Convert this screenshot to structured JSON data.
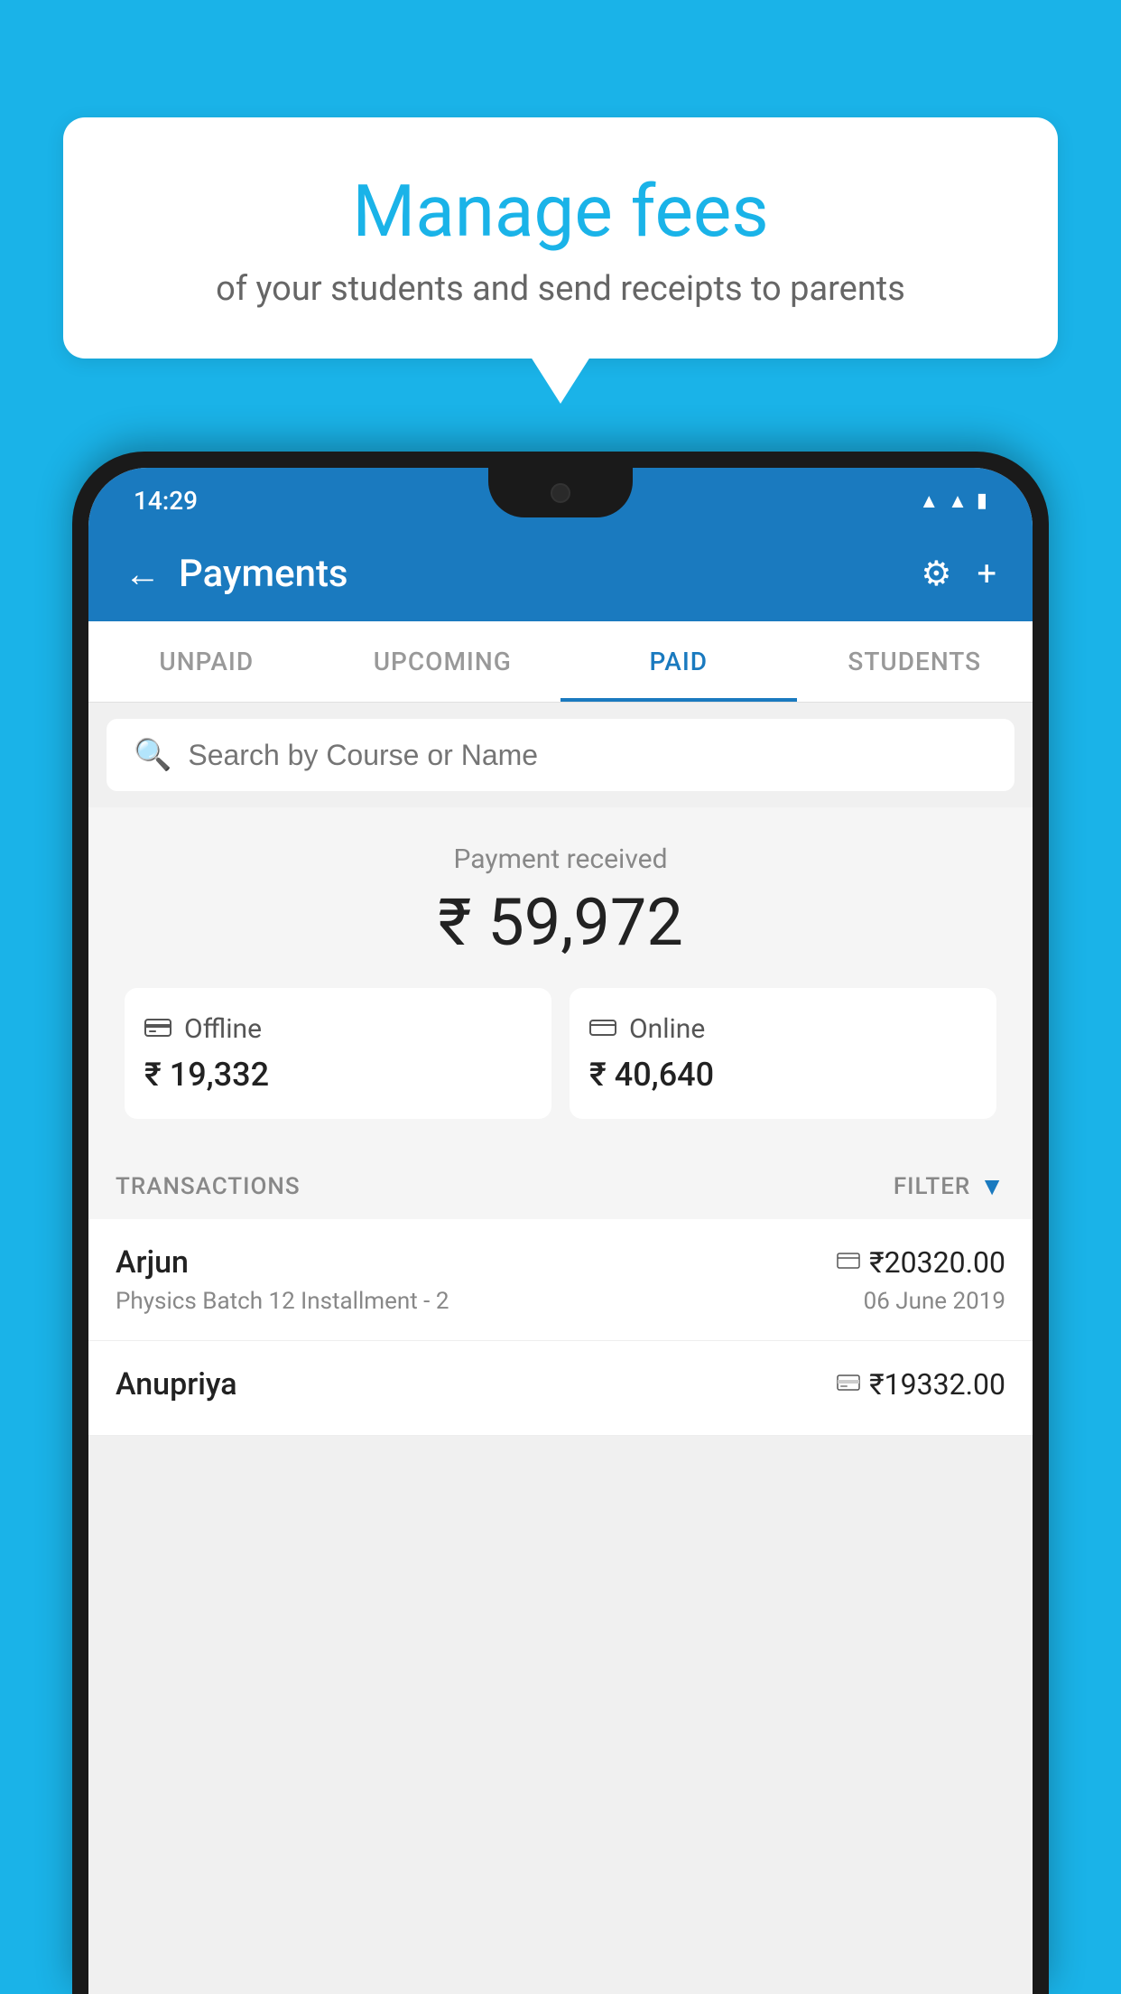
{
  "background_color": "#1ab3e8",
  "bubble": {
    "title": "Manage fees",
    "subtitle": "of your students and send receipts to parents"
  },
  "status_bar": {
    "time": "14:29",
    "wifi_icon": "▲",
    "signal_icon": "▲",
    "battery_icon": "▮"
  },
  "header": {
    "back_label": "←",
    "title": "Payments",
    "settings_icon": "⚙",
    "add_icon": "+"
  },
  "tabs": [
    {
      "id": "unpaid",
      "label": "UNPAID",
      "active": false
    },
    {
      "id": "upcoming",
      "label": "UPCOMING",
      "active": false
    },
    {
      "id": "paid",
      "label": "PAID",
      "active": true
    },
    {
      "id": "students",
      "label": "STUDENTS",
      "active": false
    }
  ],
  "search": {
    "placeholder": "Search by Course or Name"
  },
  "payment_summary": {
    "label": "Payment received",
    "total": "₹ 59,972",
    "offline_label": "Offline",
    "offline_amount": "₹ 19,332",
    "online_label": "Online",
    "online_amount": "₹ 40,640"
  },
  "transactions": {
    "header_label": "TRANSACTIONS",
    "filter_label": "FILTER"
  },
  "transaction_list": [
    {
      "name": "Arjun",
      "course": "Physics Batch 12 Installment - 2",
      "amount": "₹20320.00",
      "date": "06 June 2019",
      "pay_type": "card"
    },
    {
      "name": "Anupriya",
      "course": "",
      "amount": "₹19332.00",
      "date": "",
      "pay_type": "cash"
    }
  ]
}
